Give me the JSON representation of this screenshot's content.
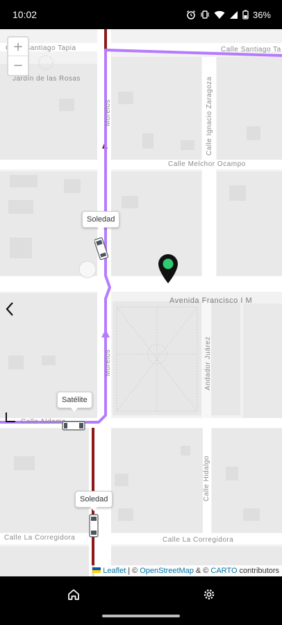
{
  "status_bar": {
    "time": "10:02",
    "battery_percent": "36%",
    "icons": [
      "alarm-icon",
      "vibrate-icon",
      "wifi-icon",
      "signal-icon",
      "battery-icon"
    ]
  },
  "map": {
    "zoom_in_label": "+",
    "zoom_out_label": "−",
    "streets": {
      "top": "Calle Santiago Tapia",
      "top_right": "Calle Santiago Ta",
      "jardin": "Jardín de las Rosas",
      "ignacio": "Calle Ignacio Zaragoza",
      "melchor": "Calle Melchor Ocampo",
      "madero": "Avenida Francisco I M",
      "andador": "Andador Juárez",
      "aldama": "Calle Aldama",
      "hidalgo": "Calle Hidalgo",
      "corregidora_left": "Calle La Corregidora",
      "corregidora_right": "Calle La Corregidora",
      "vertical_a": "Morelos",
      "vertical_b": "Morelos"
    },
    "buses": [
      {
        "label": "Soledad"
      },
      {
        "label": "Satélite"
      },
      {
        "label": "Soledad"
      }
    ],
    "colors": {
      "route": "#b57bff",
      "road_dark": "#8b1a1a",
      "marker_dot": "#2ecc71"
    },
    "attribution": {
      "leaflet": "Leaflet",
      "sep": "|",
      "copy1": "©",
      "osm": "OpenStreetMap",
      "amp": "& ©",
      "carto": "CARTO",
      "contributors": "contributors"
    }
  },
  "nav": {
    "home_icon": "home-icon",
    "settings_icon": "gear-icon"
  }
}
